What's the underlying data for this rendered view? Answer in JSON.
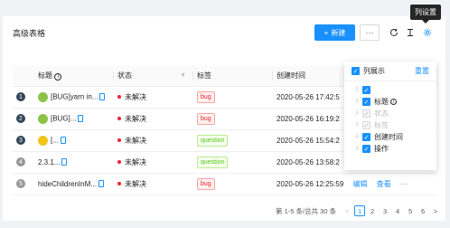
{
  "toolbar": {
    "title": "高级表格",
    "new_label": "新建",
    "more_label": "···",
    "tooltip": "列设置"
  },
  "table": {
    "columns": [
      "标题",
      "状态",
      "标签",
      "创建时间"
    ],
    "rows": [
      {
        "index": "1",
        "title": "[BUG]yarn in...",
        "status": "未解决",
        "tag": "bug",
        "tag_color": "red",
        "created": "2020-05-26 17:42:5"
      },
      {
        "index": "2",
        "title": "[BUG]...",
        "status": "未解决",
        "tag": "bug",
        "tag_color": "red",
        "created": "2020-05-26 16:19:2"
      },
      {
        "index": "3",
        "title": "[...",
        "status": "未解决",
        "tag": "question",
        "tag_color": "green",
        "created": "2020-05-26 15:54:2"
      },
      {
        "index": "4",
        "title": "2.3.1...",
        "status": "未解决",
        "tag": "question",
        "tag_color": "green",
        "created": "2020-05-26 13:58:2"
      },
      {
        "index": "5",
        "title": "hideChildrenInM...",
        "status": "未解决",
        "tag": "bug",
        "tag_color": "red",
        "created": "2020-05-26 12:25:59",
        "actions": [
          "编辑",
          "查看"
        ],
        "more": "···"
      }
    ]
  },
  "pagination": {
    "summary": "第 1-5 条/总共 30 条",
    "prev": "<",
    "pages": [
      "1",
      "2",
      "3",
      "4",
      "5",
      "6"
    ],
    "current": "1",
    "next": ">"
  },
  "column_settings": {
    "header_label": "列展示",
    "reset_label": "重置",
    "items": [
      {
        "label": "",
        "checked": true,
        "disabled": false,
        "has_info": false
      },
      {
        "label": "标题",
        "checked": true,
        "disabled": false,
        "has_info": true
      },
      {
        "label": "状态",
        "checked": true,
        "disabled": true,
        "has_info": false
      },
      {
        "label": "标签",
        "checked": true,
        "disabled": true,
        "has_info": false
      },
      {
        "label": "创建时间",
        "checked": true,
        "disabled": false,
        "has_info": false
      },
      {
        "label": "操作",
        "checked": true,
        "disabled": false,
        "has_info": false
      }
    ]
  }
}
